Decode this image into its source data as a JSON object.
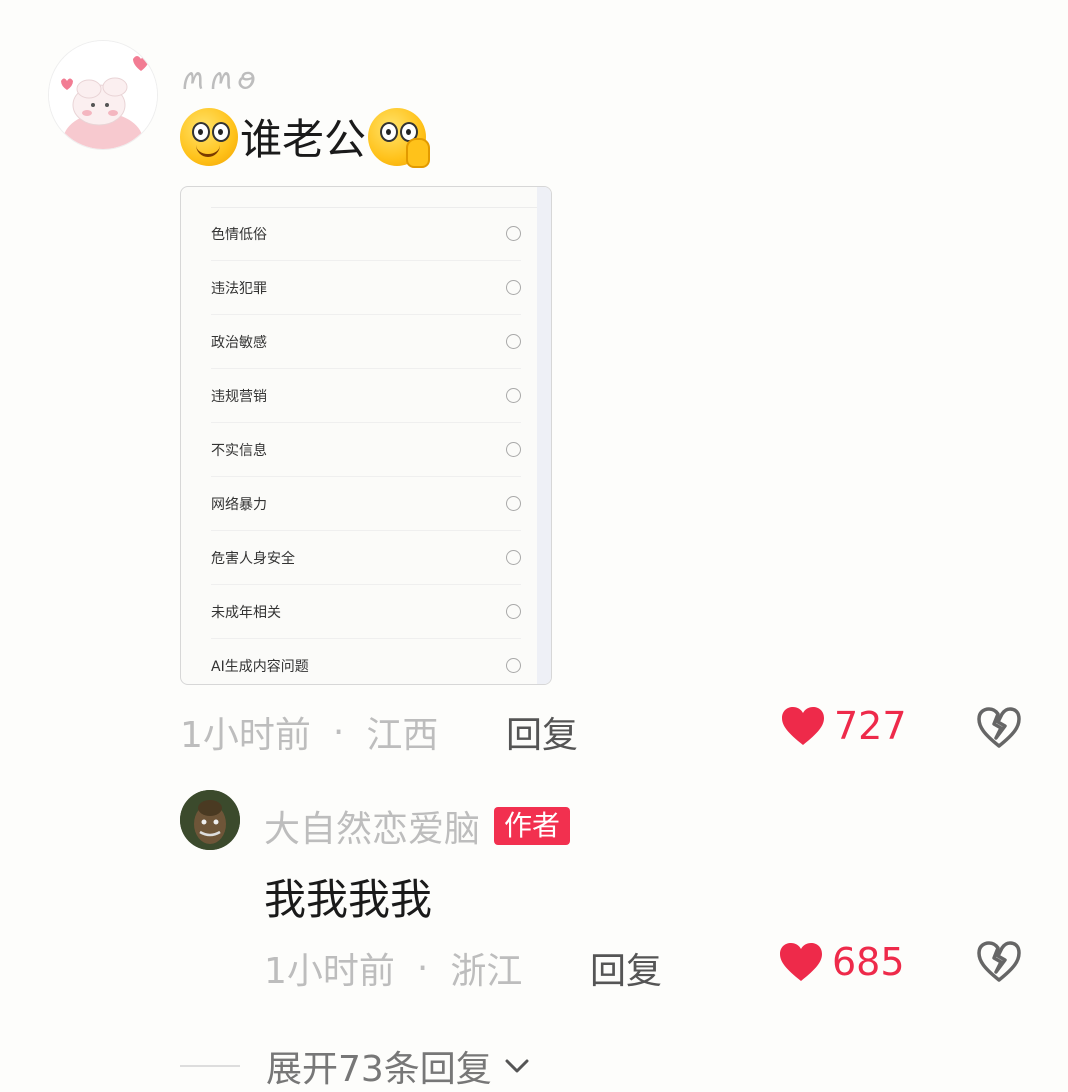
{
  "comment": {
    "username": "ꪔꪔꪮ",
    "text": "谁老公",
    "emoji_left": "smile-emoji",
    "emoji_right": "shush-emoji",
    "time": "1小时前",
    "separator": "·",
    "location": "江西",
    "reply_label": "回复",
    "likes": "727",
    "report_options": [
      "色情低俗",
      "违法犯罪",
      "政治敏感",
      "违规营销",
      "不实信息",
      "网络暴力",
      "危害人身安全",
      "未成年相关",
      "AI生成内容问题"
    ]
  },
  "reply": {
    "username": "大自然恋爱脑",
    "badge": "作者",
    "text": "我我我我",
    "time": "1小时前",
    "separator": "·",
    "location": "浙江",
    "reply_label": "回复",
    "likes": "685"
  },
  "expand": {
    "label": "展开73条回复"
  },
  "colors": {
    "like_red": "#ee2a4a",
    "badge_red": "#f2304f",
    "muted_text": "#bdbdbd"
  }
}
